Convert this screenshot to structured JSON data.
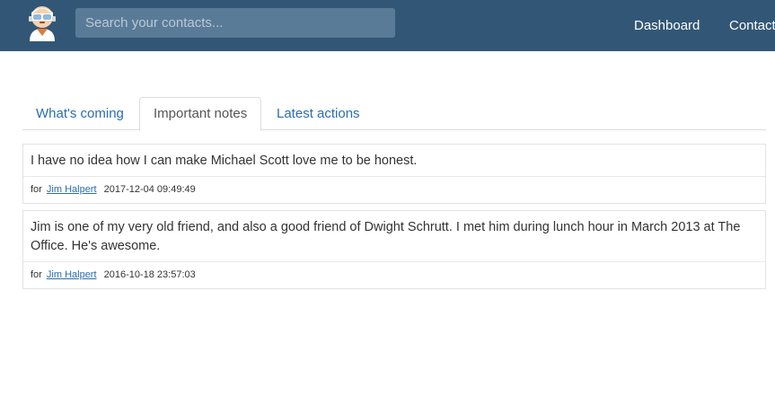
{
  "header": {
    "search_placeholder": "Search your contacts...",
    "nav": {
      "dashboard": "Dashboard",
      "contacts": "Contacts"
    },
    "brand_color": "#325776"
  },
  "tabs": [
    {
      "label": "What's coming"
    },
    {
      "label": "Important notes"
    },
    {
      "label": "Latest actions"
    }
  ],
  "notes": [
    {
      "text": "I have no idea how I can make Michael Scott love me to be honest.",
      "for_label": "for",
      "contact": "Jim Halpert",
      "timestamp": "2017-12-04 09:49:49"
    },
    {
      "text": "Jim is one of my very old friend, and also a good friend of Dwight Schrutt. I met him during lunch hour in March 2013 at The Office. He's awesome.",
      "for_label": "for",
      "contact": "Jim Halpert",
      "timestamp": "2016-10-18 23:57:03"
    }
  ]
}
